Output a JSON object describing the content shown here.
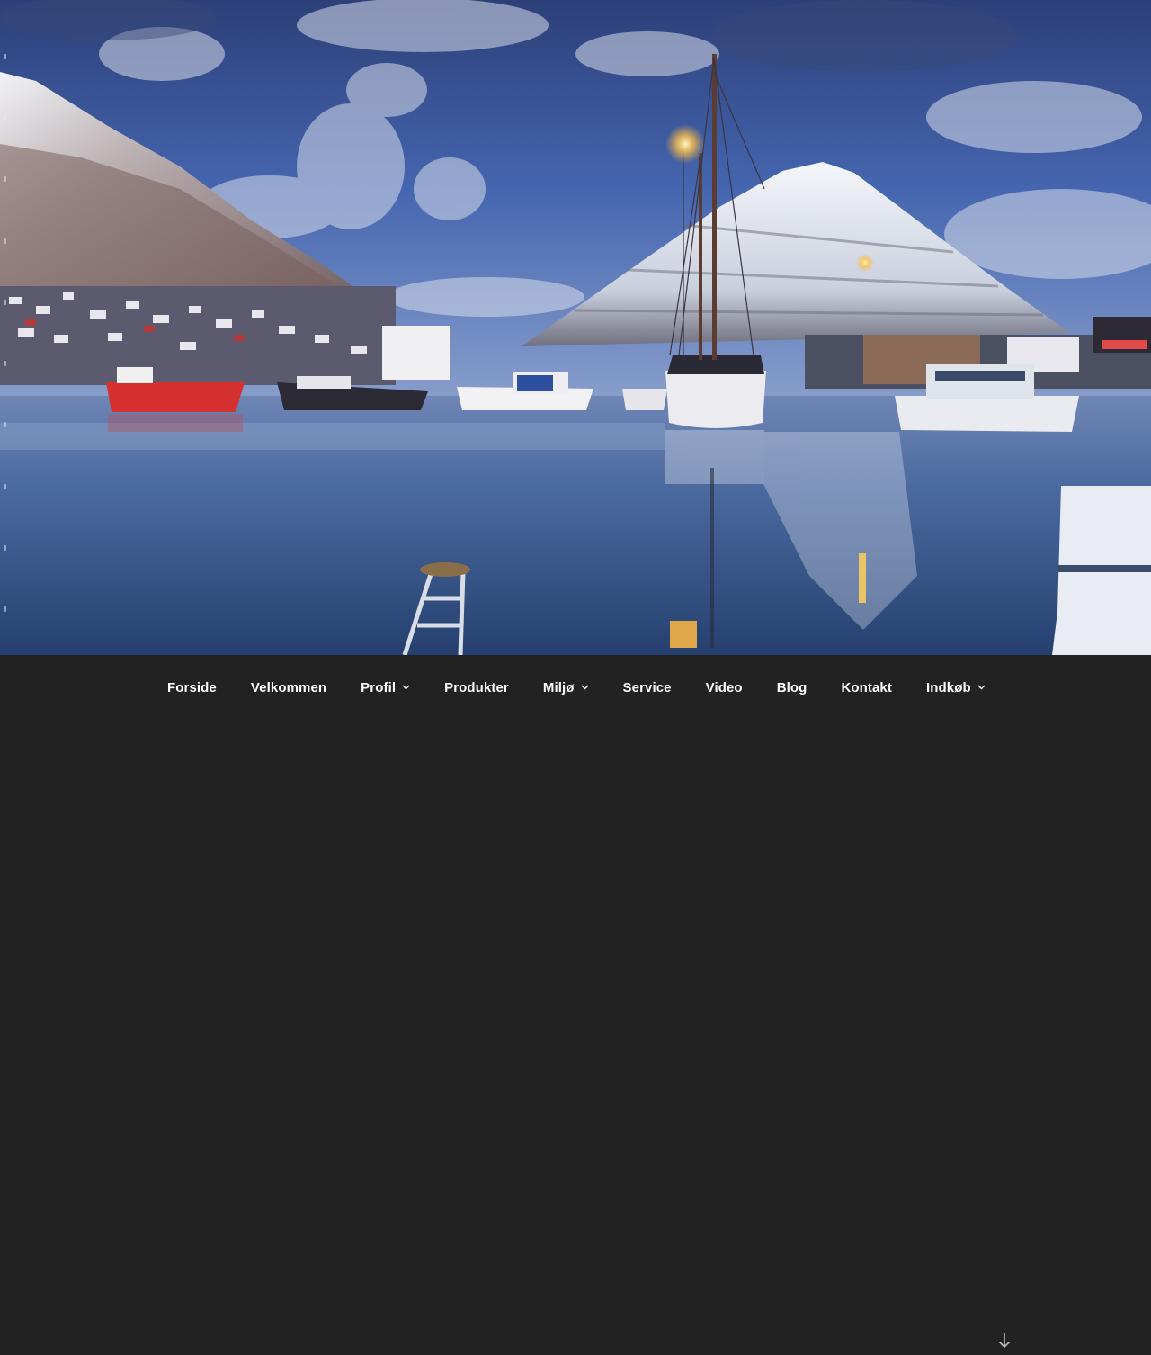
{
  "hero": {
    "image_description_icon": "harbor-photo",
    "sky_color": "#3f5c9c",
    "water_color": "#2f4f80"
  },
  "nav": {
    "items": [
      {
        "label": "Forside",
        "dropdown": false
      },
      {
        "label": "Velkommen",
        "dropdown": false
      },
      {
        "label": "Profil",
        "dropdown": true
      },
      {
        "label": "Produkter",
        "dropdown": false
      },
      {
        "label": "Miljø",
        "dropdown": true
      },
      {
        "label": "Service",
        "dropdown": false
      },
      {
        "label": "Video",
        "dropdown": false
      },
      {
        "label": "Blog",
        "dropdown": false
      },
      {
        "label": "Kontakt",
        "dropdown": false
      },
      {
        "label": "Indkøb",
        "dropdown": true
      }
    ],
    "background": "#222222",
    "text_color": "#ffffff",
    "scroll_icon": "arrow-down-icon"
  }
}
